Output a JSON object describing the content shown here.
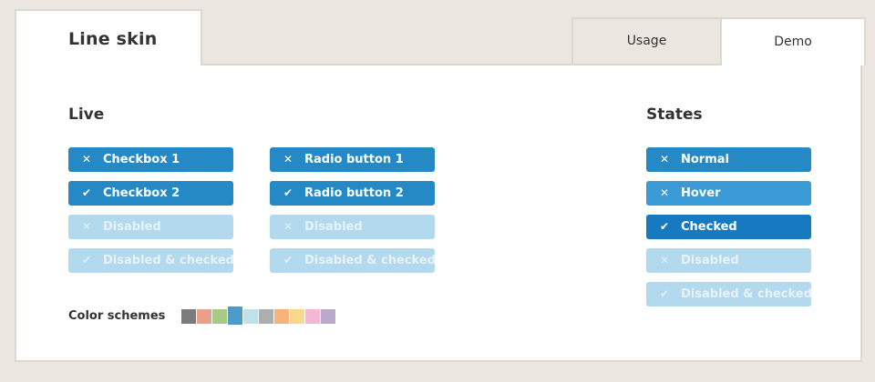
{
  "tabs": {
    "main_title": "Line skin",
    "usage": "Usage",
    "demo": "Demo"
  },
  "live": {
    "title": "Live",
    "checkboxes": [
      {
        "label": "Checkbox 1",
        "icon": "x-icon",
        "state": "normal"
      },
      {
        "label": "Checkbox 2",
        "icon": "check-icon",
        "state": "checked"
      },
      {
        "label": "Disabled",
        "icon": "x-icon",
        "state": "disabled"
      },
      {
        "label": "Disabled & checked",
        "icon": "check-icon",
        "state": "disabled-checked"
      }
    ],
    "radios": [
      {
        "label": "Radio button 1",
        "icon": "x-icon",
        "state": "normal"
      },
      {
        "label": "Radio button 2",
        "icon": "check-icon",
        "state": "checked"
      },
      {
        "label": "Disabled",
        "icon": "x-icon",
        "state": "disabled"
      },
      {
        "label": "Disabled & checked",
        "icon": "check-icon",
        "state": "disabled-checked"
      }
    ]
  },
  "states": {
    "title": "States",
    "items": [
      {
        "label": "Normal",
        "icon": "x-icon"
      },
      {
        "label": "Hover",
        "icon": "x-icon"
      },
      {
        "label": "Checked",
        "icon": "check-icon"
      },
      {
        "label": "Disabled",
        "icon": "x-icon"
      },
      {
        "label": "Disabled & checked",
        "icon": "check-icon"
      }
    ]
  },
  "color_schemes": {
    "label": "Color schemes",
    "colors": [
      "#7c7c7c",
      "#e8a08a",
      "#a7cb85",
      "#4b9bcb",
      "#c1e1ea",
      "#adaeae",
      "#f8b27c",
      "#f8d88a",
      "#f4b6d2",
      "#b9a9cb"
    ],
    "active_index": 3
  },
  "colors": {
    "accent": "#2489c5",
    "hover": "#3a9bd7",
    "checked": "#177ac0",
    "disabled": "#b3d9ee",
    "background": "#ebe7e0",
    "border": "#ddd8ce"
  }
}
